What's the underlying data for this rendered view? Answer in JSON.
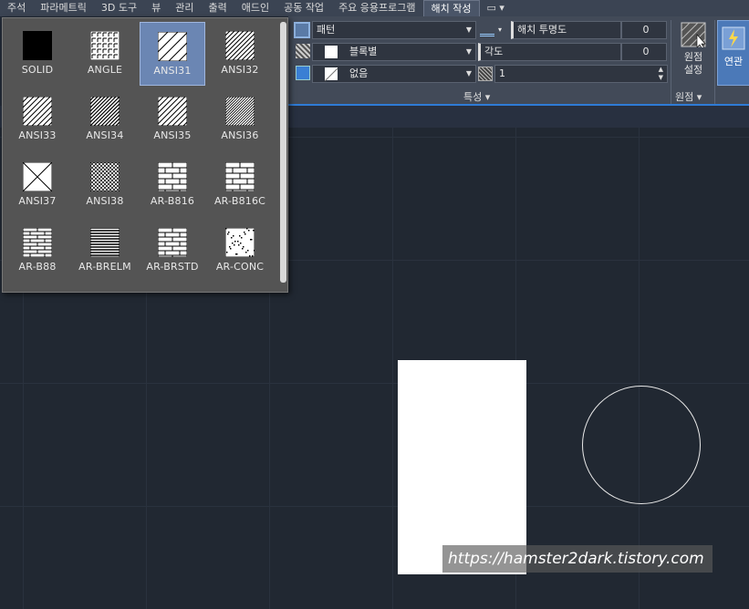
{
  "menu": [
    "주석",
    "파라메트릭",
    "3D 도구",
    "뷰",
    "관리",
    "출력",
    "애드인",
    "공동 작업",
    "주요 응용프로그램",
    "해치 작성",
    "▭ ▾"
  ],
  "patterns": [
    "SOLID",
    "ANGLE",
    "ANSI31",
    "ANSI32",
    "ANSI33",
    "ANSI34",
    "ANSI35",
    "ANSI36",
    "ANSI37",
    "ANSI38",
    "AR-B816",
    "AR-B816C",
    "AR-B88",
    "AR-BRELM",
    "AR-BRSTD",
    "AR-CONC"
  ],
  "selected_pattern": "ANSI31",
  "ribbon": {
    "type_value": "패턴",
    "color_value": "블록별",
    "bg_value": "없음",
    "transparency_label": "해치 투명도",
    "transparency_value": "0",
    "angle_label": "각도",
    "angle_value": "0",
    "scale_value": "1",
    "props_label": "특성 ▾",
    "origin_btn": "원점\n설정",
    "origin_label": "원점 ▾",
    "assoc_btn": "연관"
  },
  "watermark": "https://hamster2dark.tistory.com",
  "colors": {
    "accent": "#2e7bd6",
    "selected": "#6b86b3"
  }
}
